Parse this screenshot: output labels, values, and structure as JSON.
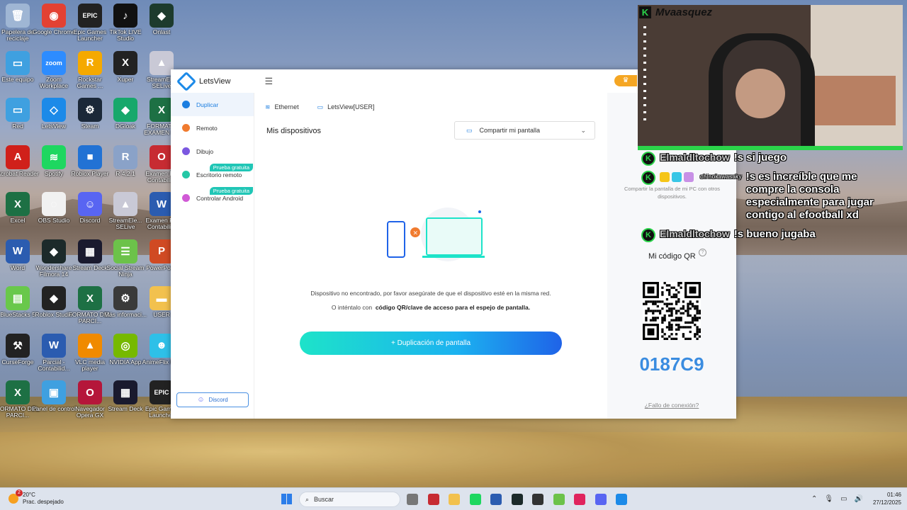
{
  "desktop": {
    "icons": [
      {
        "label": "Papelera de reciclaje",
        "color": "#9fb6d4",
        "glyph": "🗑"
      },
      {
        "label": "Google Chrome",
        "color": "#e34133",
        "glyph": "◉"
      },
      {
        "label": "Epic Games Launcher",
        "color": "#222222",
        "glyph": "EPIC"
      },
      {
        "label": "TikTok LIVE Studio",
        "color": "#111111",
        "glyph": "♪"
      },
      {
        "label": "Onlast",
        "color": "#1d3b2d",
        "glyph": "◆"
      },
      {
        "label": "Este equipo",
        "color": "#3fa0e0",
        "glyph": "▭"
      },
      {
        "label": "Zoom Workplace",
        "color": "#2d8cff",
        "glyph": "zoom"
      },
      {
        "label": "Rockstar Games ...",
        "color": "#f5a900",
        "glyph": "R"
      },
      {
        "label": "Xuper",
        "color": "#222222",
        "glyph": "X"
      },
      {
        "label": "StreamEl... SELive",
        "color": "#c9c9d6",
        "glyph": "▲"
      },
      {
        "label": "Red",
        "color": "#3fa0e0",
        "glyph": "▭"
      },
      {
        "label": "LetsView",
        "color": "#1c8ae8",
        "glyph": "◇"
      },
      {
        "label": "Steam",
        "color": "#1b2838",
        "glyph": "⚙"
      },
      {
        "label": "DGloak",
        "color": "#17a86b",
        "glyph": "◆"
      },
      {
        "label": "FORMATO EXAMEN F...",
        "color": "#1d7044",
        "glyph": "X"
      },
      {
        "label": "Acrobat Reader",
        "color": "#d0201a",
        "glyph": "A"
      },
      {
        "label": "Spotify",
        "color": "#1ed760",
        "glyph": "≋"
      },
      {
        "label": "Roblox Player",
        "color": "#2272d4",
        "glyph": "■"
      },
      {
        "label": "R 4.2.1",
        "color": "#8aa2c8",
        "glyph": "R"
      },
      {
        "label": "Examen F... Contabili...",
        "color": "#c72b32",
        "glyph": "O"
      },
      {
        "label": "Excel",
        "color": "#1d7044",
        "glyph": "X"
      },
      {
        "label": "OBS Studio",
        "color": "#f1f1f1",
        "glyph": "◌"
      },
      {
        "label": "Discord",
        "color": "#5865f2",
        "glyph": "☺"
      },
      {
        "label": "StreamEle... SELive",
        "color": "#c9c9d6",
        "glyph": "▲"
      },
      {
        "label": "Examen F... Contabili...",
        "color": "#2b5cb0",
        "glyph": "W"
      },
      {
        "label": "Word",
        "color": "#2b5cb0",
        "glyph": "W"
      },
      {
        "label": "Wondershare Filmora 14",
        "color": "#1c2a2a",
        "glyph": "◆"
      },
      {
        "label": "Stream Deck",
        "color": "#1a1a2e",
        "glyph": "▦"
      },
      {
        "label": "Social Stream Ninja",
        "color": "#6cc24a",
        "glyph": "☰"
      },
      {
        "label": "PowerPoint",
        "color": "#d04a23",
        "glyph": "P"
      },
      {
        "label": "BlueStacks 5",
        "color": "#69c84b",
        "glyph": "▤"
      },
      {
        "label": "Roblox Studio",
        "color": "#222222",
        "glyph": "◆"
      },
      {
        "label": "FORMATO DEL PARCI...",
        "color": "#1d7044",
        "glyph": "X"
      },
      {
        "label": "Más informaci...",
        "color": "#3a3a3a",
        "glyph": "⚙"
      },
      {
        "label": "USER",
        "color": "#f2c14e",
        "glyph": "▬"
      },
      {
        "label": "CurseForge",
        "color": "#222222",
        "glyph": "⚒"
      },
      {
        "label": "Parcial - Contabilid...",
        "color": "#2b5cb0",
        "glyph": "W"
      },
      {
        "label": "VLC media player",
        "color": "#f08a00",
        "glyph": "▲"
      },
      {
        "label": "NVIDIA App",
        "color": "#76b900",
        "glyph": "◎"
      },
      {
        "label": "AnimeFlix FLV",
        "color": "#2ec0e8",
        "glyph": "☻"
      },
      {
        "label": "FORMATO DEL PARCI...",
        "color": "#1d7044",
        "glyph": "X"
      },
      {
        "label": "Panel de control",
        "color": "#3fa0e0",
        "glyph": "▣"
      },
      {
        "label": "Navegador Opera GX",
        "color": "#b5163a",
        "glyph": "O"
      },
      {
        "label": "Stream Deck",
        "color": "#1a1a2e",
        "glyph": "▦"
      },
      {
        "label": "Epic Games Launcher",
        "color": "#222222",
        "glyph": "EPIC"
      }
    ]
  },
  "app": {
    "title": "LetsView",
    "sidebar": [
      {
        "label": "Duplicar",
        "color": "#1c7ee0",
        "active": true,
        "badge": ""
      },
      {
        "label": "Remoto",
        "color": "#f07b2f",
        "active": false,
        "badge": ""
      },
      {
        "label": "Dibujo",
        "color": "#7b58e0",
        "active": false,
        "badge": ""
      },
      {
        "label": "Escritorio remoto",
        "color": "#25c8a6",
        "active": false,
        "badge": "Prueba gratuita"
      },
      {
        "label": "Controlar Android",
        "color": "#d15ad6",
        "active": false,
        "badge": "Prueba gratuita"
      }
    ],
    "discord_button": "Discord",
    "tabs": [
      {
        "icon": "wifi-icon",
        "label": "Ethernet"
      },
      {
        "icon": "monitor-icon",
        "label": "LetsView[USER]"
      }
    ],
    "devices_header": "Mis dispositivos",
    "share_select": "Compartir mi pantalla",
    "not_found": "Dispositivo no encontrado, por favor asegúrate de que el dispositivo esté en la misma red.",
    "try_prefix": "O inténtalo con",
    "try_bold": "código QR/clave de acceso para el espejo de pantalla.",
    "duplicate_button": "+ Duplicación de pantalla",
    "right": {
      "description": "Compartir la pantalla de mi PC con otros dispositivos.",
      "qr_title": "Mi código QR",
      "help": "?",
      "code": "0187C9",
      "connection_fail": "¿Fallo de conexión?"
    }
  },
  "stream": {
    "streamer": "Mvaasquez",
    "chat": [
      {
        "user": "Elmaldltochow",
        "message": "!s si juego",
        "small": false
      },
      {
        "user": "chinokawasaky",
        "message": "!s es increíble que me compre la consola especialmente para jugar contigo al efootball xd",
        "small": true
      },
      {
        "user": "Elmaldltochow",
        "message": "!s bueno jugaba",
        "small": false
      }
    ]
  },
  "taskbar": {
    "temperature": "20°C",
    "weather": "Prac. despejado",
    "weather_badge": "2",
    "search_placeholder": "Buscar",
    "time": "01:46",
    "date": "27/12/2025"
  },
  "colors": {
    "accent": "#1c7ee0",
    "code_blue": "#3a8ce0",
    "stream_green": "#2bd44a"
  }
}
